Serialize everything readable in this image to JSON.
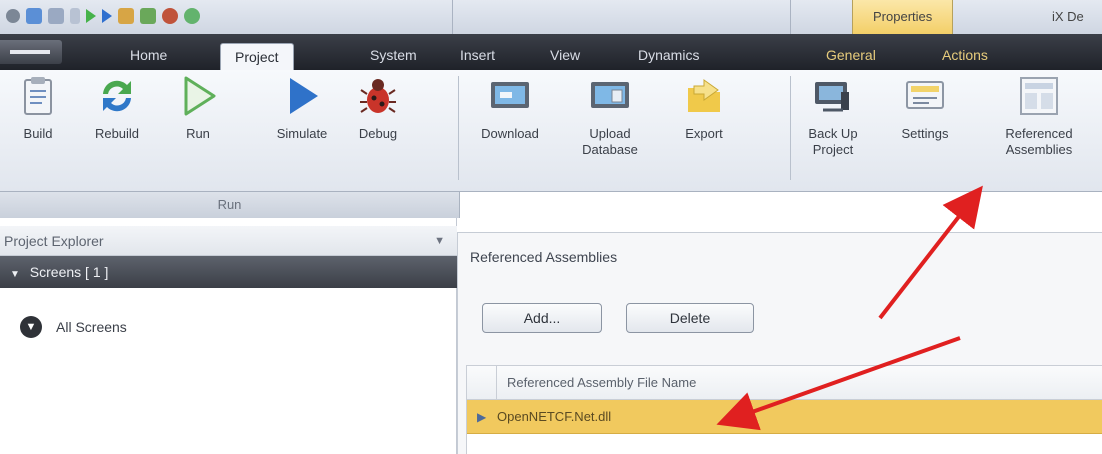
{
  "title_tabs": [
    "Properties",
    "iX De"
  ],
  "menu_tabs": [
    "Home",
    "Project",
    "System",
    "Insert",
    "View",
    "Dynamics",
    "General",
    "Actions"
  ],
  "active_tab": "Project",
  "ribbon": {
    "run_group": {
      "label": "Run",
      "buttons": [
        "Build",
        "Rebuild",
        "Run",
        "Simulate",
        "Debug"
      ]
    },
    "transfer_buttons": [
      {
        "line1": "Download",
        "line2": ""
      },
      {
        "line1": "Upload",
        "line2": "Database"
      },
      {
        "line1": "Export",
        "line2": ""
      }
    ],
    "project_buttons": [
      {
        "line1": "Back Up",
        "line2": "Project"
      },
      {
        "line1": "Settings",
        "line2": ""
      },
      {
        "line1": "Referenced",
        "line2": "Assemblies"
      }
    ]
  },
  "explorer": {
    "title": "Project Explorer",
    "screens_header": "Screens [ 1 ]",
    "all_screens": "All Screens"
  },
  "ref_panel": {
    "title": "Referenced Assemblies",
    "add_label": "Add...",
    "delete_label": "Delete",
    "column_header": "Referenced Assembly File Name",
    "rows": [
      "OpenNETCF.Net.dll"
    ]
  },
  "colors": {
    "ribbon_dark": "#2b2f37",
    "context_tab_text": "#e7cc7c",
    "selected_row": "#f1c95e",
    "arrow": "#e02020"
  }
}
